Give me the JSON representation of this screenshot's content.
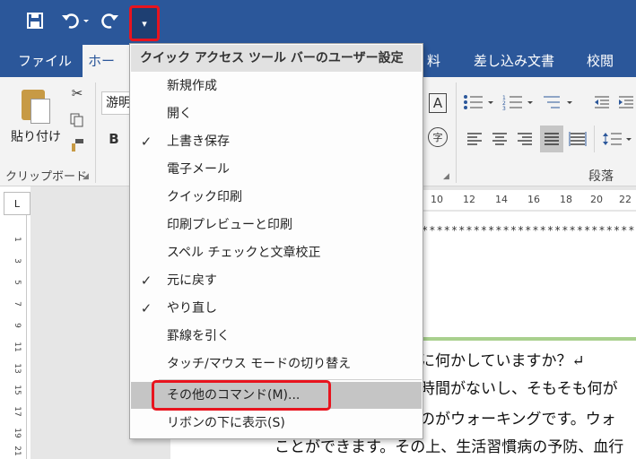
{
  "colors": {
    "title_bar": "#2b579a",
    "highlight_border": "#e8141e",
    "menu_hover": "#c5c5c5"
  },
  "qat": {
    "save_icon": "save-icon",
    "undo_icon": "undo-icon",
    "redo_icon": "redo-icon",
    "customize_icon": "customize-dropdown-icon",
    "customize_glyph": "▾"
  },
  "tabs": [
    {
      "label": "ファイル"
    },
    {
      "label": "ホーム"
    },
    {
      "label": "料"
    },
    {
      "label": "差し込み文書"
    },
    {
      "label": "校閲"
    }
  ],
  "ribbon": {
    "paste_label": "貼り付け",
    "clipboard_group_label": "クリップボード",
    "font_box_value": "游明",
    "bold_label": "B",
    "paragraph_group_label": "段落",
    "text_box_glyph": "A",
    "phonetic_glyph": "字"
  },
  "ruler": {
    "corner_glyph": "L",
    "h_ticks": [
      "10",
      "12",
      "14",
      "16",
      "18",
      "20",
      "22"
    ],
    "v_numbers": [
      "1",
      "3",
      "5",
      "7",
      "9",
      "11",
      "13",
      "15",
      "17",
      "19",
      "21"
    ]
  },
  "document": {
    "stars": "****************************************",
    "lines": [
      "に何かしていますか？↵",
      "時間がないし、そもそも何が",
      "のがウォーキングです。ウォ",
      "ことができます。その上、生活習慣病の予防、血行"
    ]
  },
  "menu": {
    "header": "クイック アクセス ツール バーのユーザー設定",
    "items": [
      {
        "label": "新規作成",
        "checked": ""
      },
      {
        "label": "開く",
        "checked": ""
      },
      {
        "label": "上書き保存",
        "checked": "✓"
      },
      {
        "label": "電子メール",
        "checked": ""
      },
      {
        "label": "クイック印刷",
        "checked": ""
      },
      {
        "label": "印刷プレビューと印刷",
        "checked": ""
      },
      {
        "label": "スペル チェックと文章校正",
        "checked": ""
      },
      {
        "label": "元に戻す",
        "checked": "✓"
      },
      {
        "label": "やり直し",
        "checked": "✓"
      },
      {
        "label": "罫線を引く",
        "checked": ""
      },
      {
        "label": "タッチ/マウス モードの切り替え",
        "checked": ""
      },
      {
        "label": "その他のコマンド(M)...",
        "checked": ""
      },
      {
        "label": "リボンの下に表示(S)",
        "checked": ""
      }
    ]
  }
}
